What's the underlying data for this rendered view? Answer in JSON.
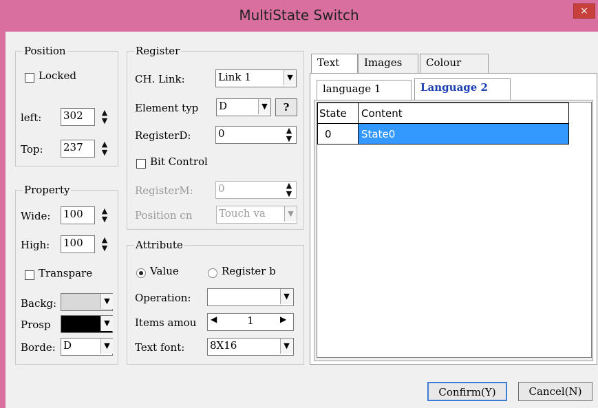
{
  "window": {
    "title": "MultiState Switch",
    "close_glyph": "×"
  },
  "position": {
    "group_title": "Position",
    "locked_label": "Locked",
    "left_label": "left:",
    "left_value": "302",
    "top_label": "Top:",
    "top_value": "237"
  },
  "property": {
    "group_title": "Property",
    "wide_label": "Wide:",
    "wide_value": "100",
    "high_label": "High:",
    "high_value": "100",
    "transparent_label": "Transpare",
    "background_label": "Backg:",
    "prospect_label": "Prosp",
    "border_label": "Borde:",
    "border_value": "D"
  },
  "register": {
    "group_title": "Register",
    "ch_link_label": "CH. Link:",
    "ch_link_value": "Link 1",
    "element_type_label": "Element typ",
    "element_type_value": "D",
    "help_button": "?",
    "register_d_label": "RegisterD:",
    "register_d_value": "0",
    "bit_control_label": "Bit Control",
    "register_m_label": "RegisterM:",
    "register_m_value": "0",
    "position_cn_label": "Position cn",
    "position_cn_value": "Touch va"
  },
  "attribute": {
    "group_title": "Attribute",
    "value_radio": "Value",
    "register_radio": "Register b",
    "operation_label": "Operation:",
    "operation_value": "",
    "items_amount_label": "Items amou",
    "items_amount_value": "1",
    "text_font_label": "Text font:",
    "text_font_value": "8X16"
  },
  "tabs": {
    "main": [
      "Text",
      "Images",
      "Colour"
    ],
    "sub": [
      "language 1",
      "Language 2"
    ]
  },
  "table": {
    "headers": [
      "State",
      "Content"
    ],
    "rows": [
      {
        "state": "0",
        "content": "State0"
      }
    ]
  },
  "buttons": {
    "confirm": "Confirm(Y)",
    "cancel": "Cancel(N)"
  },
  "colors": {
    "titlebar": "#d96f9e",
    "selection": "#3399ff",
    "prospect_swatch": "#000000"
  }
}
